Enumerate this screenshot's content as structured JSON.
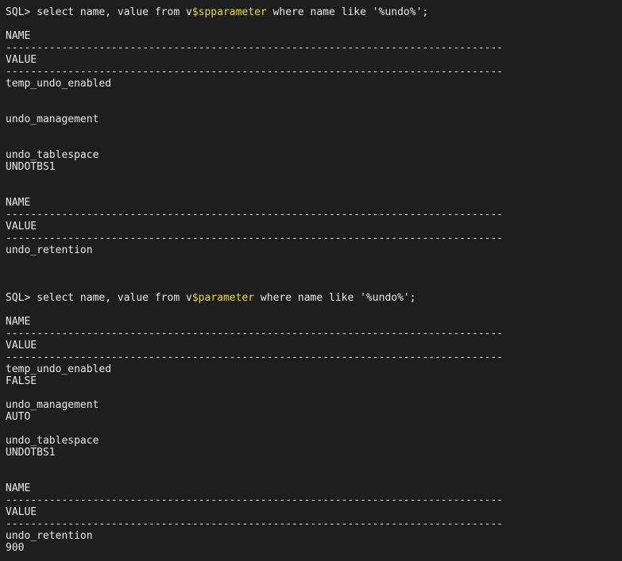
{
  "colors": {
    "background": "#1e1e1e",
    "text": "#e8e8e8",
    "highlight": "#e6d93c"
  },
  "dashes": "--------------------------------------------------------------------------------",
  "query1": {
    "prefix": "SQL> select name, value from v",
    "highlight": "$spparameter",
    "suffix": " where name like '%undo%';",
    "header_name": "NAME",
    "header_value": "VALUE",
    "rows": [
      {
        "name": "temp_undo_enabled",
        "value": ""
      },
      {
        "name": "undo_management",
        "value": ""
      },
      {
        "name": "undo_tablespace",
        "value": "UNDOTBS1"
      }
    ],
    "header2_name": "NAME",
    "header2_value": "VALUE",
    "rows2": [
      {
        "name": "undo_retention",
        "value": ""
      }
    ]
  },
  "query2": {
    "prefix": "SQL> select name, value from v",
    "highlight": "$parameter",
    "suffix": " where name like '%undo%';",
    "header_name": "NAME",
    "header_value": "VALUE",
    "rows": [
      {
        "name": "temp_undo_enabled",
        "value": "FALSE"
      },
      {
        "name": "undo_management",
        "value": "AUTO"
      },
      {
        "name": "undo_tablespace",
        "value": "UNDOTBS1"
      }
    ],
    "header2_name": "NAME",
    "header2_value": "VALUE",
    "rows2": [
      {
        "name": "undo_retention",
        "value": "900"
      }
    ]
  }
}
